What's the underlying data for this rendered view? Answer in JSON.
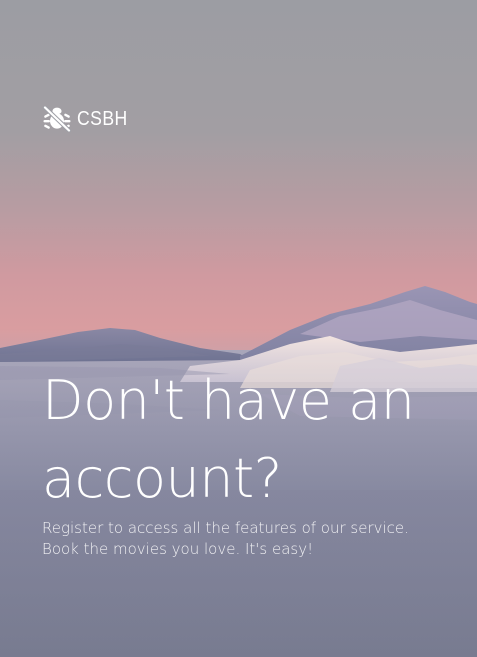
{
  "brand": {
    "name": "CSBH",
    "icon": "no-bug-icon"
  },
  "hero": {
    "headline_line1": "Don't have an",
    "headline_line2": "account?",
    "subtitle_line1": "Register to access all the features of our service.",
    "subtitle_line2": "Book the movies you love. It's easy!"
  }
}
